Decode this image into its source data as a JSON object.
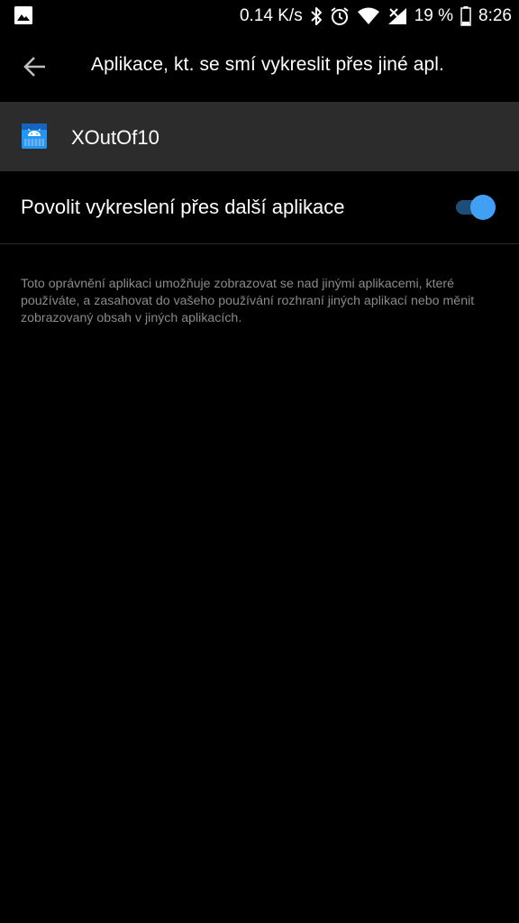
{
  "status_bar": {
    "speed": "0.14 K/s",
    "battery_percent": "19 %",
    "time": "8:26",
    "icons": [
      "image-icon",
      "bluetooth-icon",
      "alarm-icon",
      "wifi-icon",
      "cellular-no-signal-icon",
      "battery-icon"
    ]
  },
  "toolbar": {
    "title": "Aplikace, kt. se smí vykreslit přes jiné apl."
  },
  "app": {
    "name": "XOutOf10",
    "icon": "android-app-icon"
  },
  "permission": {
    "label": "Povolit vykreslení přes další aplikace",
    "enabled": true,
    "description": "Toto oprávnění aplikaci umožňuje zobrazovat se nad jinými aplikacemi, které používáte, a zasahovat do vašeho používání rozhraní jiných aplikací nebo měnit zobrazovaný obsah v jiných aplikacích."
  },
  "colors": {
    "background": "#000000",
    "app_row": "#2c2c2c",
    "accent": "#42a0f4",
    "switch_track": "#1d4e7a",
    "description_text": "#8a8a8a"
  }
}
